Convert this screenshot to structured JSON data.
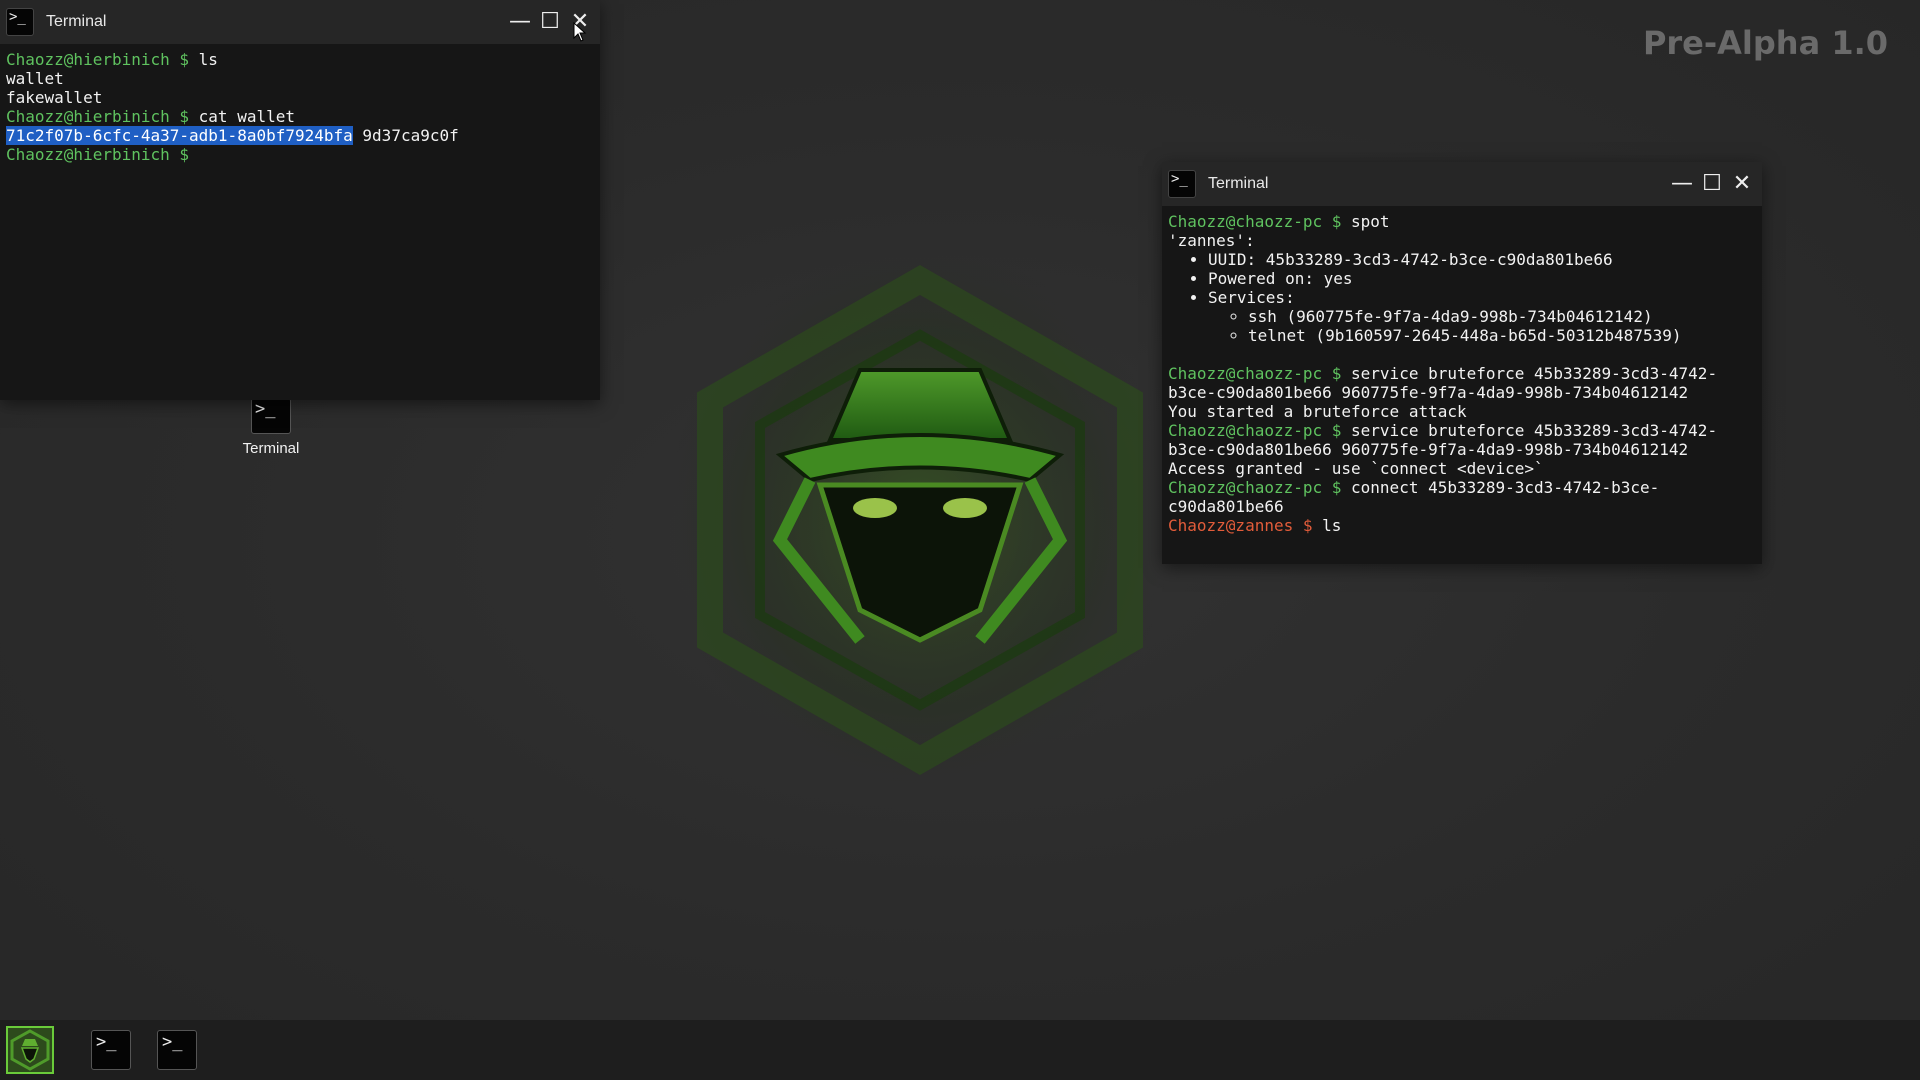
{
  "desktop": {
    "version": "Pre-Alpha 1.0",
    "icons": [
      {
        "label": "Terminal",
        "icon": "terminal-icon"
      }
    ]
  },
  "window_left": {
    "title": "Terminal",
    "icon": "terminal-icon",
    "lines": [
      {
        "prompt": "Chaozz@hierbinich $",
        "cmd": " ls"
      },
      {
        "text": "wallet"
      },
      {
        "text": "fakewallet"
      },
      {
        "prompt": "Chaozz@hierbinich $",
        "cmd": " cat wallet"
      },
      {
        "selected": "71c2f07b-6cfc-4a37-adb1-8a0bf7924bfa",
        "rest": " 9d37ca9c0f"
      },
      {
        "prompt": "Chaozz@hierbinich $",
        "cmd": ""
      }
    ]
  },
  "window_right": {
    "title": "Terminal",
    "icon": "terminal-icon",
    "spot_prompt": "Chaozz@chaozz-pc $",
    "spot_cmd": " spot",
    "device_name": "'zannes':",
    "uuid": "UUID: 45b33289-3cd3-4742-b3ce-c90da801be66",
    "powered": "Powered on: yes",
    "services_label": "Services:",
    "services": [
      "ssh (960775fe-9f7a-4da9-998b-734b04612142)",
      "telnet (9b160597-2645-448a-b65d-50312b487539)"
    ],
    "lines": [
      {
        "prompt": "Chaozz@chaozz-pc $",
        "cmd": " service bruteforce 45b33289-3cd3-4742-"
      },
      {
        "text": "b3ce-c90da801be66 960775fe-9f7a-4da9-998b-734b04612142"
      },
      {
        "text": "You started a bruteforce attack"
      },
      {
        "prompt": "Chaozz@chaozz-pc $",
        "cmd": " service bruteforce 45b33289-3cd3-4742-"
      },
      {
        "text": "b3ce-c90da801be66 960775fe-9f7a-4da9-998b-734b04612142"
      },
      {
        "text": "Access granted - use `connect <device>`"
      },
      {
        "prompt": "Chaozz@chaozz-pc $",
        "cmd": " connect 45b33289-3cd3-4742-b3ce-"
      },
      {
        "text": "c90da801be66"
      },
      {
        "prompt_remote": "Chaozz@zannes $",
        "cmd": " ls"
      }
    ]
  },
  "taskbar": {
    "items": [
      "launcher-icon",
      "terminal-icon",
      "terminal-icon"
    ]
  },
  "controls": {
    "minimize": "—",
    "maximize": "☐",
    "close": "✕"
  },
  "colors": {
    "prompt_local": "#5fc25f",
    "prompt_remote": "#e25c3a",
    "selection": "#1f5fc4"
  }
}
